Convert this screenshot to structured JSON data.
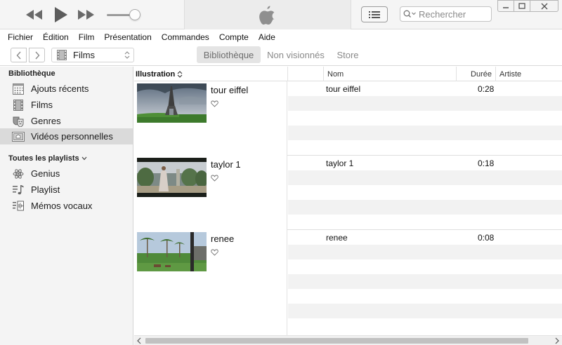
{
  "player": {
    "rewind_icon": "rewind-icon",
    "play_icon": "play-icon",
    "forward_icon": "fast-forward-icon",
    "volume_level": 0.85,
    "search_placeholder": "Rechercher"
  },
  "menu": [
    "Fichier",
    "Édition",
    "Film",
    "Présentation",
    "Commandes",
    "Compte",
    "Aide"
  ],
  "nav": {
    "media_type": "Films",
    "tabs": [
      {
        "label": "Bibliothèque",
        "active": true
      },
      {
        "label": "Non visionnés",
        "active": false
      },
      {
        "label": "Store",
        "active": false
      }
    ]
  },
  "sidebar": {
    "library_heading": "Bibliothèque",
    "library_items": [
      {
        "label": "Ajouts récents",
        "icon": "calendar-grid-icon"
      },
      {
        "label": "Films",
        "icon": "film-icon"
      },
      {
        "label": "Genres",
        "icon": "theater-masks-icon"
      },
      {
        "label": "Vidéos personnelles",
        "icon": "home-video-icon",
        "selected": true
      }
    ],
    "playlists_heading": "Toutes les playlists",
    "playlist_items": [
      {
        "label": "Genius",
        "icon": "atom-icon"
      },
      {
        "label": "Playlist",
        "icon": "music-list-icon"
      },
      {
        "label": "Mémos vocaux",
        "icon": "voice-memo-icon"
      }
    ]
  },
  "table": {
    "columns": {
      "artwork": "Illustration",
      "name": "Nom",
      "duration": "Durée",
      "artist": "Artiste"
    },
    "videos": [
      {
        "title": "tour eiffel",
        "name": "tour eiffel",
        "duration": "0:28",
        "artist": ""
      },
      {
        "title": "taylor 1",
        "name": "taylor 1",
        "duration": "0:18",
        "artist": ""
      },
      {
        "title": "renee",
        "name": "renee",
        "duration": "0:08",
        "artist": ""
      }
    ]
  },
  "colors": {
    "sidebar_bg": "#f4f4f4",
    "selected_bg": "#dadada",
    "alt_row": "#f2f2f2"
  }
}
